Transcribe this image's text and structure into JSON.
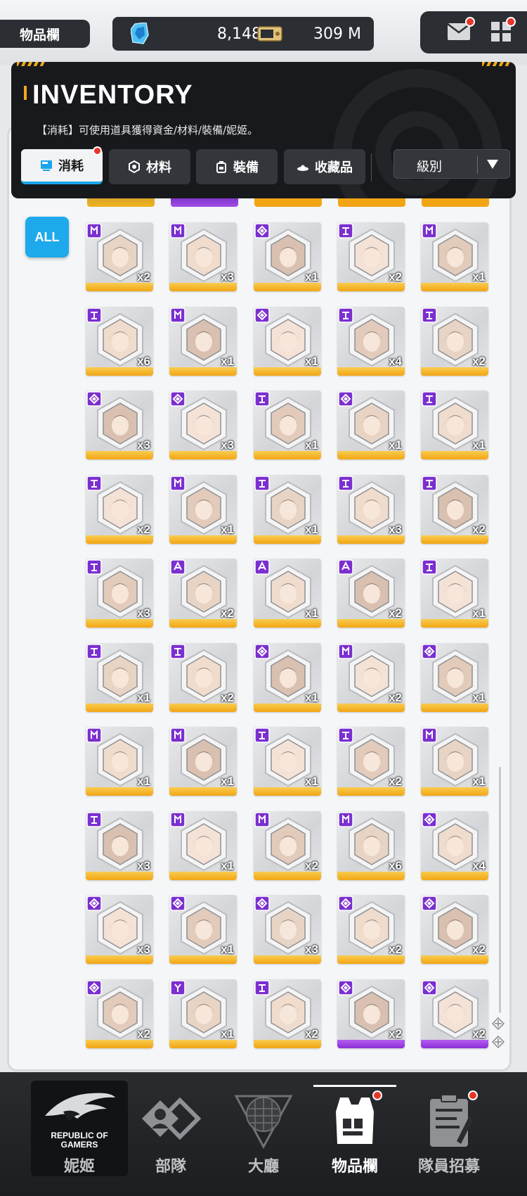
{
  "topbar": {
    "title": "物品欄",
    "gems": "8,148",
    "gems_plus": "+",
    "gold": "309 M"
  },
  "header": {
    "title": "INVENTORY",
    "description": "【消耗】可使用道具獲得資金/材料/裝備/妮姬。",
    "tabs": [
      {
        "label": "消耗",
        "icon": "consumable-icon",
        "active": true
      },
      {
        "label": "材料",
        "icon": "material-icon",
        "active": false
      },
      {
        "label": "裝備",
        "icon": "equipment-icon",
        "active": false
      },
      {
        "label": "收藏品",
        "icon": "collectible-icon",
        "active": false
      }
    ],
    "sort_label": "級別"
  },
  "filter": {
    "all_label": "ALL"
  },
  "items": [
    [
      {
        "q": "x2",
        "c": "gold",
        "b": "M"
      },
      {
        "q": "x3",
        "c": "gold",
        "b": "M"
      },
      {
        "q": "x1",
        "c": "gold",
        "b": "D"
      },
      {
        "q": "x2",
        "c": "gold",
        "b": "T"
      },
      {
        "q": "x1",
        "c": "gold",
        "b": "M"
      }
    ],
    [
      {
        "q": "x6",
        "c": "gold",
        "b": "T"
      },
      {
        "q": "x1",
        "c": "gold",
        "b": "M"
      },
      {
        "q": "x1",
        "c": "gold",
        "b": "D"
      },
      {
        "q": "x4",
        "c": "gold",
        "b": "T"
      },
      {
        "q": "x2",
        "c": "gold",
        "b": "T"
      }
    ],
    [
      {
        "q": "x3",
        "c": "gold",
        "b": "D"
      },
      {
        "q": "x3",
        "c": "gold",
        "b": "D"
      },
      {
        "q": "x1",
        "c": "gold",
        "b": "T"
      },
      {
        "q": "x1",
        "c": "gold",
        "b": "D"
      },
      {
        "q": "x1",
        "c": "gold",
        "b": "T"
      }
    ],
    [
      {
        "q": "x2",
        "c": "gold",
        "b": "T"
      },
      {
        "q": "x1",
        "c": "gold",
        "b": "M"
      },
      {
        "q": "x1",
        "c": "gold",
        "b": "T"
      },
      {
        "q": "x3",
        "c": "gold",
        "b": "T"
      },
      {
        "q": "x2",
        "c": "gold",
        "b": "T"
      }
    ],
    [
      {
        "q": "x3",
        "c": "gold",
        "b": "T"
      },
      {
        "q": "x2",
        "c": "gold",
        "b": "E"
      },
      {
        "q": "x1",
        "c": "gold",
        "b": "E"
      },
      {
        "q": "x2",
        "c": "gold",
        "b": "E"
      },
      {
        "q": "x1",
        "c": "gold",
        "b": "T"
      }
    ],
    [
      {
        "q": "x1",
        "c": "gold",
        "b": "T"
      },
      {
        "q": "x2",
        "c": "gold",
        "b": "T"
      },
      {
        "q": "x1",
        "c": "gold",
        "b": "D"
      },
      {
        "q": "x2",
        "c": "gold",
        "b": "M"
      },
      {
        "q": "x1",
        "c": "gold",
        "b": "D"
      }
    ],
    [
      {
        "q": "x1",
        "c": "gold",
        "b": "M"
      },
      {
        "q": "x1",
        "c": "gold",
        "b": "M"
      },
      {
        "q": "x1",
        "c": "gold",
        "b": "T"
      },
      {
        "q": "x2",
        "c": "gold",
        "b": "T"
      },
      {
        "q": "x1",
        "c": "gold",
        "b": "M"
      }
    ],
    [
      {
        "q": "x3",
        "c": "gold",
        "b": "T"
      },
      {
        "q": "x1",
        "c": "gold",
        "b": "M"
      },
      {
        "q": "x2",
        "c": "gold",
        "b": "M"
      },
      {
        "q": "x6",
        "c": "gold",
        "b": "M"
      },
      {
        "q": "x4",
        "c": "gold",
        "b": "D"
      }
    ],
    [
      {
        "q": "x3",
        "c": "gold",
        "b": "D"
      },
      {
        "q": "x1",
        "c": "gold",
        "b": "D"
      },
      {
        "q": "x3",
        "c": "gold",
        "b": "D"
      },
      {
        "q": "x2",
        "c": "gold",
        "b": "D"
      },
      {
        "q": "x2",
        "c": "gold",
        "b": "D"
      }
    ],
    [
      {
        "q": "x2",
        "c": "gold",
        "b": "D"
      },
      {
        "q": "x1",
        "c": "gold",
        "b": "Y"
      },
      {
        "q": "x2",
        "c": "gold",
        "b": "T"
      },
      {
        "q": "x2",
        "c": "purple",
        "b": "D"
      },
      {
        "q": "x2",
        "c": "purple",
        "b": "D"
      }
    ]
  ],
  "nav": [
    {
      "label": "妮姬",
      "active": false,
      "dot": false
    },
    {
      "label": "部隊",
      "active": false,
      "dot": false
    },
    {
      "label": "大廳",
      "active": false,
      "dot": false
    },
    {
      "label": "物品欄",
      "active": true,
      "dot": true
    },
    {
      "label": "隊員招募",
      "active": false,
      "dot": true
    }
  ],
  "brand": {
    "line1": "REPUBLIC OF",
    "line2": "GAMERS"
  },
  "colors": {
    "accent_blue": "#1ea9ec",
    "rarity_gold": "#f2a514",
    "rarity_purple": "#8a2fd6",
    "badge_purple": "#7b2fd0",
    "notify_red": "#e8352a"
  }
}
